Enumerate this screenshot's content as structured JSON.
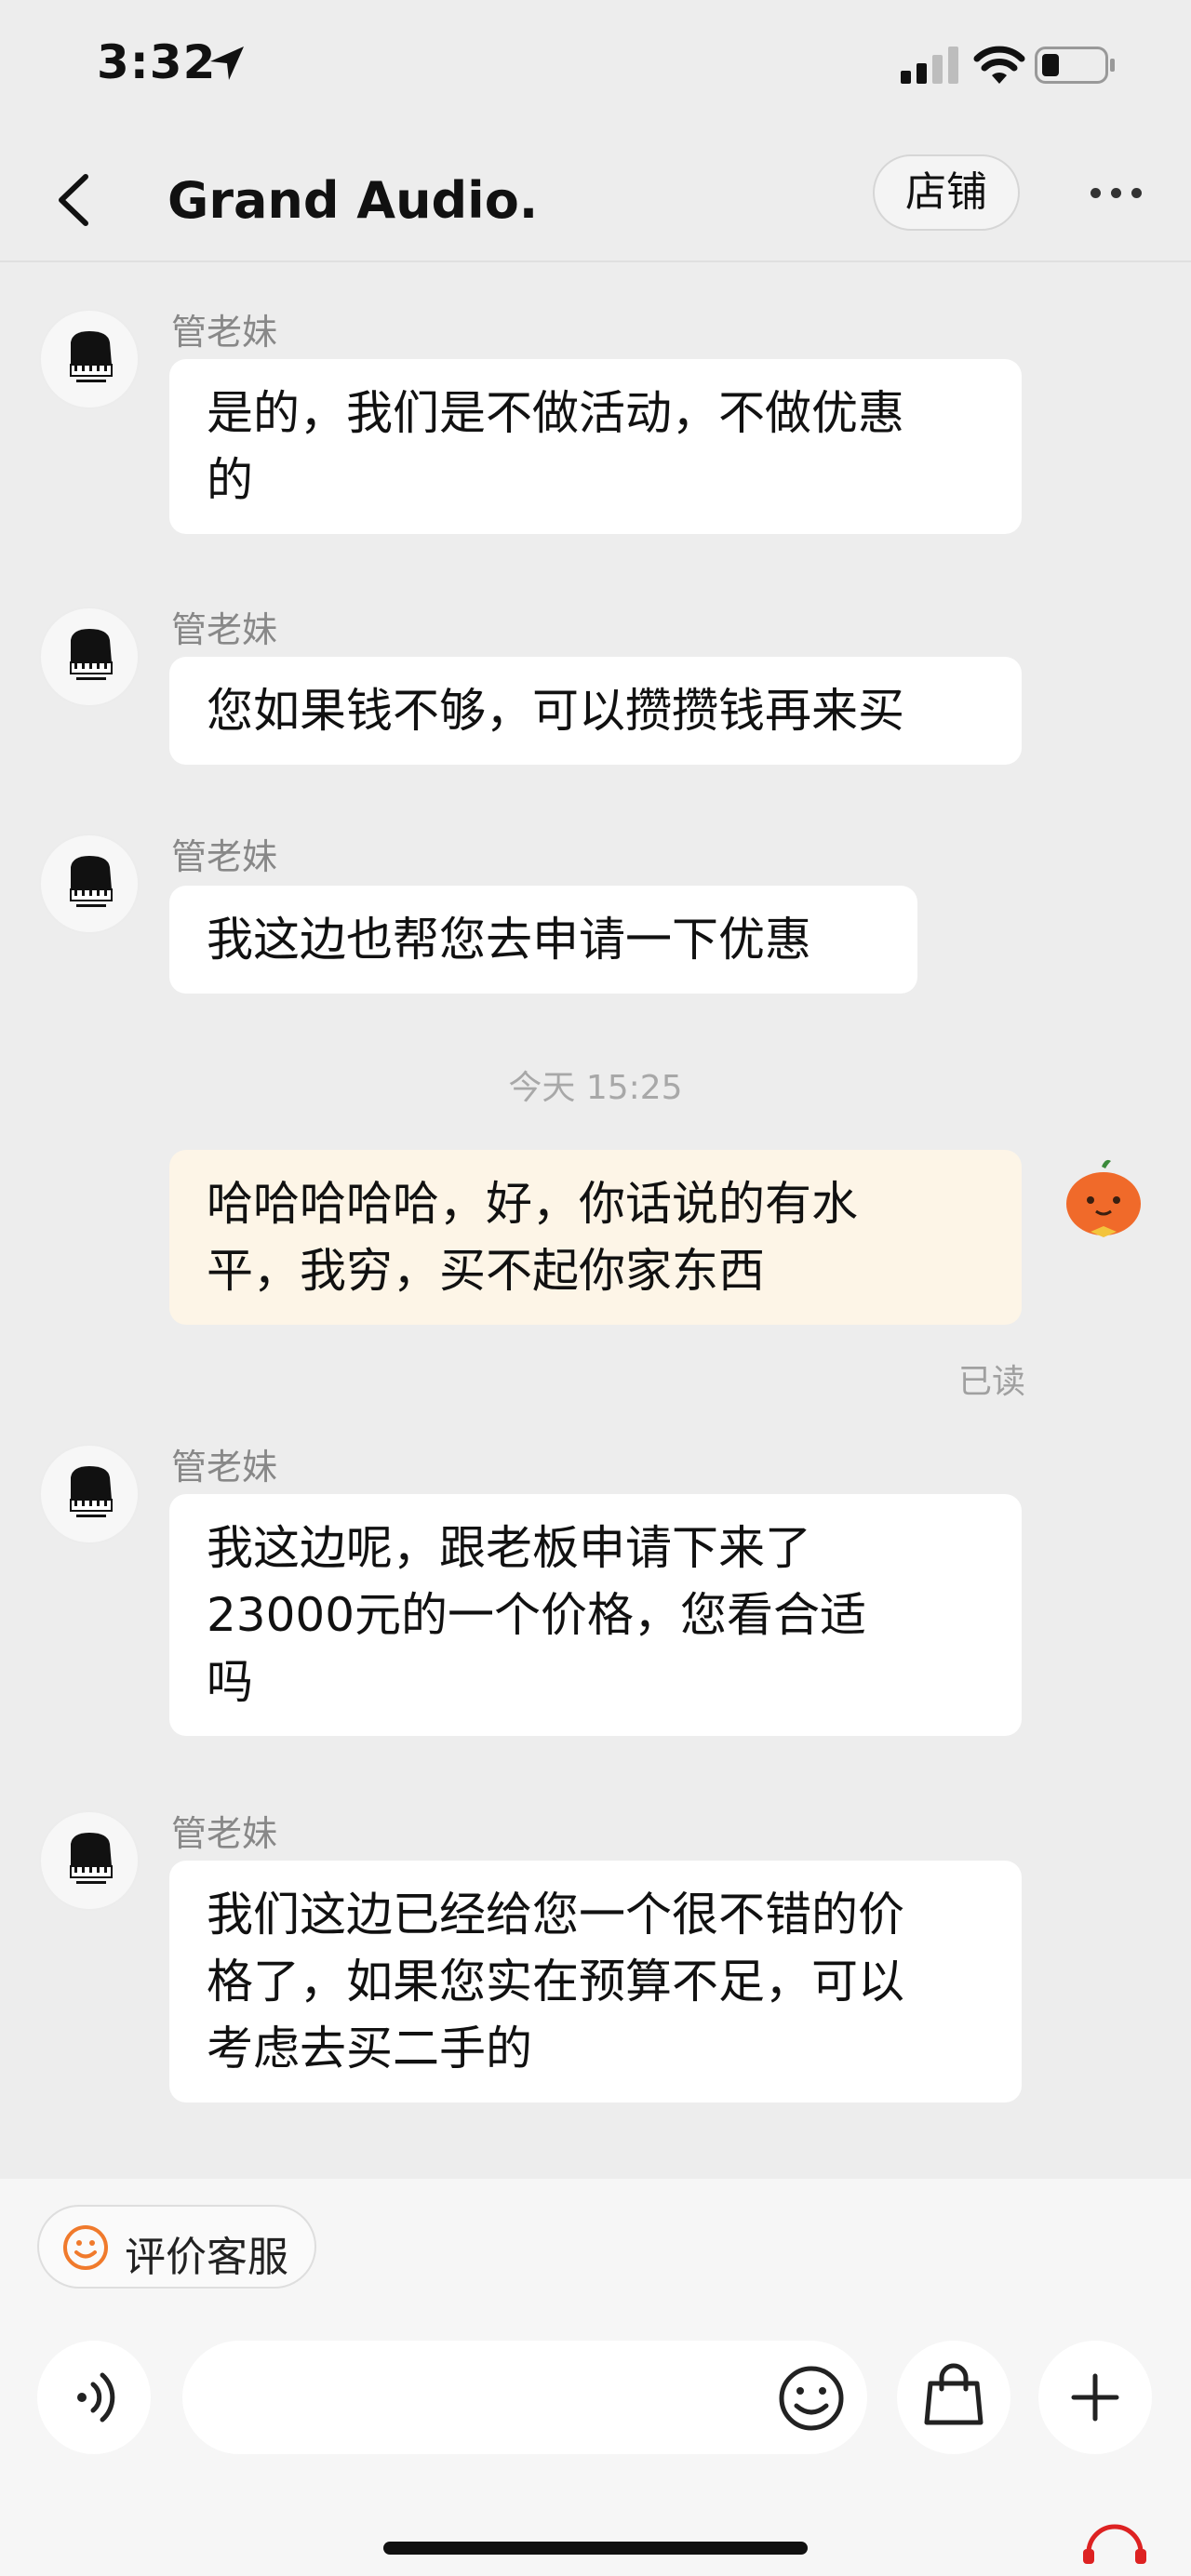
{
  "status_bar": {
    "time": "3:32"
  },
  "nav": {
    "title": "Grand Audio.",
    "shop_label": "店铺"
  },
  "messages": [
    {
      "sender": "管老妹",
      "lines": [
        "是的，我们是不做活动，不做优惠",
        "的"
      ]
    },
    {
      "sender": "管老妹",
      "lines": [
        "您如果钱不够，可以攒攒钱再来买"
      ]
    },
    {
      "sender": "管老妹",
      "lines": [
        "我这边也帮您去申请一下优惠"
      ]
    },
    {
      "timestamp": "今天 15:25"
    },
    {
      "sender": "me",
      "lines": [
        "哈哈哈哈哈，好，你话说的有水",
        "平，我穷，买不起你家东西"
      ],
      "status": "已读"
    },
    {
      "sender": "管老妹",
      "lines": [
        "我这边呢，跟老板申请下来了",
        "23000元的一个价格，您看合适",
        "吗"
      ]
    },
    {
      "sender": "管老妹",
      "lines": [
        "我们这边已经给您一个很不错的价",
        "格了，如果您实在预算不足，可以",
        "考虑去买二手的"
      ]
    }
  ],
  "bottom_bar": {
    "rate_label": "评价客服",
    "input_value": "",
    "input_placeholder": ""
  },
  "icons": {
    "back": "chevron-left-icon",
    "more": "more-dots-icon",
    "voice": "voice-icon",
    "emoji": "emoji-icon",
    "shopping_bag": "shopping-bag-icon",
    "plus": "plus-icon",
    "rate": "smile-icon"
  },
  "colors": {
    "page_bg": "#ededed",
    "bubble_other": "#ffffff",
    "bubble_mine": "#fdf5e7",
    "accent_orange": "#f07a2c"
  }
}
